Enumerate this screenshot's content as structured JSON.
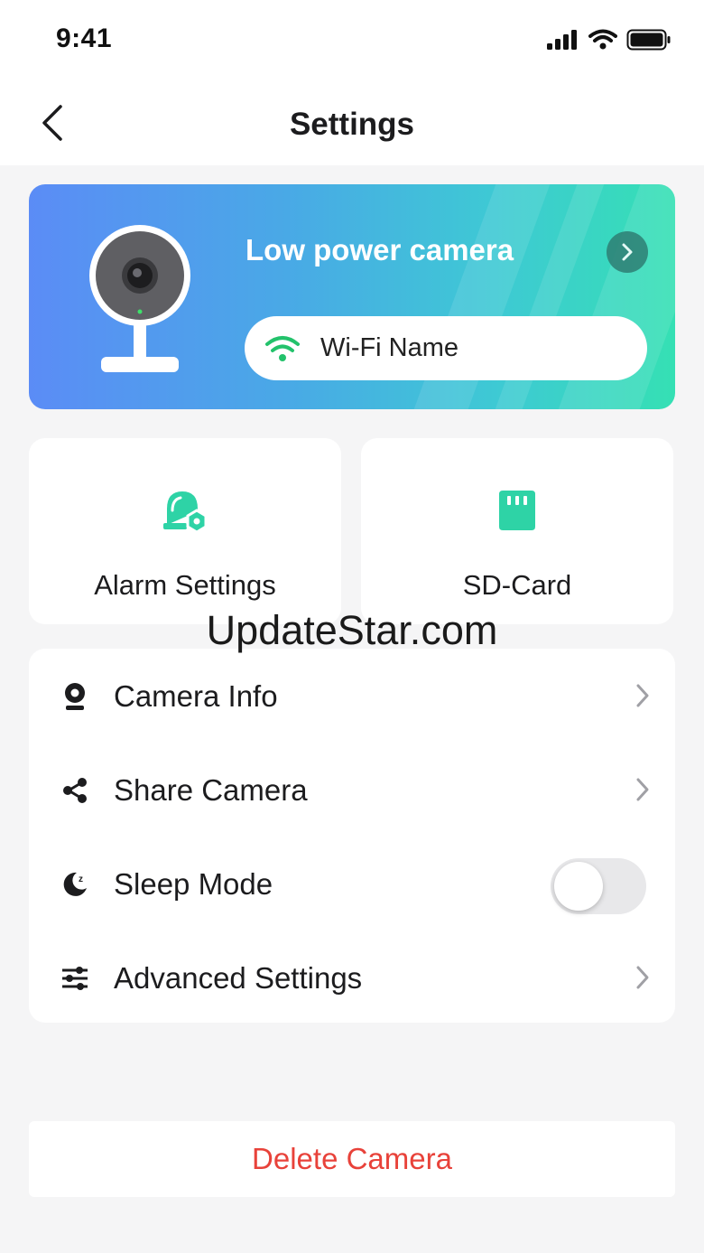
{
  "status_bar": {
    "time": "9:41"
  },
  "nav": {
    "title": "Settings"
  },
  "device": {
    "name": "Low power camera",
    "wifi_name": "Wi-Fi Name"
  },
  "tiles": [
    {
      "label": "Alarm Settings",
      "icon": "alarm-settings-icon"
    },
    {
      "label": "SD-Card",
      "icon": "sd-card-icon"
    }
  ],
  "watermark": "UpdateStar.com",
  "settings_list": [
    {
      "label": "Camera Info",
      "icon": "camera-icon",
      "control": "chevron"
    },
    {
      "label": "Share Camera",
      "icon": "share-icon",
      "control": "chevron"
    },
    {
      "label": "Sleep Mode",
      "icon": "moon-icon",
      "control": "toggle",
      "value": false
    },
    {
      "label": "Advanced Settings",
      "icon": "sliders-icon",
      "control": "chevron"
    }
  ],
  "delete_label": "Delete Camera",
  "colors": {
    "accent_green": "#2ed3a6",
    "danger": "#e8423a",
    "wifi_green": "#23c26b"
  }
}
